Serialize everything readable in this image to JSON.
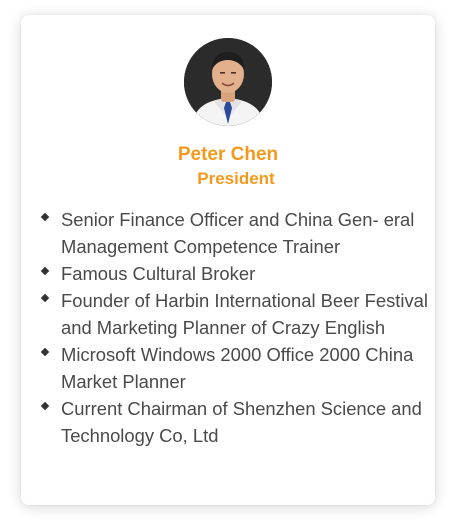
{
  "profile": {
    "name": "Peter Chen",
    "title": "President",
    "avatar_icon": "person-photo-icon",
    "accent_color": "#f39a1e",
    "bio": [
      {
        "text": "Senior Finance Officer and China Gen- eral Management Competence Trainer"
      },
      {
        "text": "Famous Cultural Broker"
      },
      {
        "text": "Founder of Harbin International Beer Festival and Marketing Planner of Crazy English"
      },
      {
        "text": "Microsoft Windows 2000 Office 2000 China Market Planner"
      },
      {
        "text": "Current Chairman of Shenzhen Science and Technology Co, Ltd"
      }
    ]
  }
}
